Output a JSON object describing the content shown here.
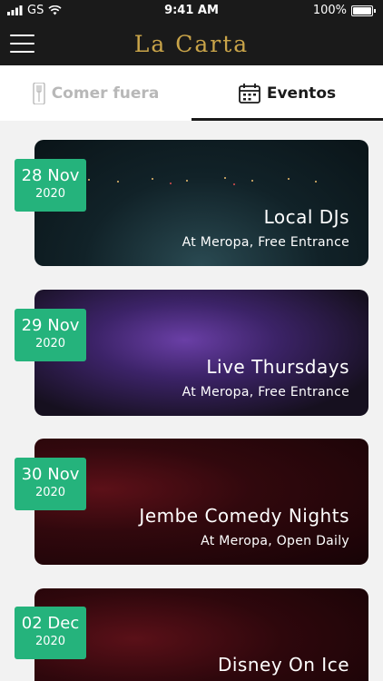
{
  "status_bar": {
    "carrier": "GS",
    "time": "9:41 AM",
    "battery": "100%"
  },
  "app": {
    "title": "La Carta"
  },
  "tabs": [
    {
      "label": "Comer fuera",
      "icon": "utensils-icon",
      "active": false
    },
    {
      "label": "Eventos",
      "icon": "calendar-icon",
      "active": true
    }
  ],
  "events": [
    {
      "day": "28 Nov",
      "year": "2020",
      "title": "Local DJs",
      "subtitle": "At Meropa, Free Entrance"
    },
    {
      "day": "29 Nov",
      "year": "2020",
      "title": "Live Thursdays",
      "subtitle": "At Meropa, Free Entrance"
    },
    {
      "day": "30 Nov",
      "year": "2020",
      "title": "Jembe Comedy Nights",
      "subtitle": "At Meropa, Open Daily"
    },
    {
      "day": "02 Dec",
      "year": "2020",
      "title": "Disney On Ice",
      "subtitle": ""
    }
  ],
  "colors": {
    "accent": "#25b37c",
    "brand": "#c9a449",
    "navbar": "#1a1a1a"
  }
}
